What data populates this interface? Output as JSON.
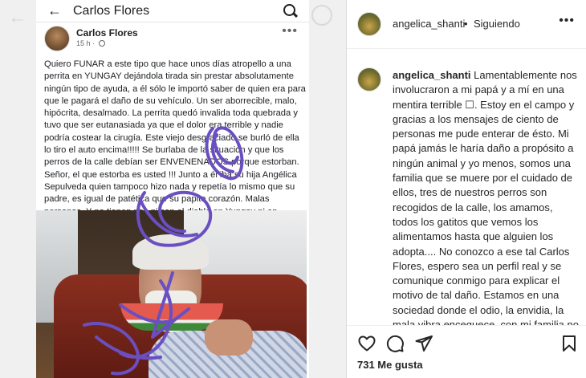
{
  "fb_post": {
    "topbar_title": "Carlos Flores",
    "author": "Carlos Flores",
    "time": "15 h",
    "text": "Quiero FUNAR  a este tipo que hace unos días atropello a una perrita en YUNGAY dejándola tirada sin prestar absolutamente ningún tipo de ayuda, a él sólo le importó saber de quien era para que le pagará el daño de su vehículo. Un ser aborrecible, malo, hipócrita, desalmado. La perrita quedó invalida toda quebrada y tuvo que ser eutanasiada ya que el dolor era terrible y nadie podría costear la cirugía. Este viejo desgraciado se burló de ella lo tiro el auto encima!!!!! Se burlaba de la situación y que los perros de la calle debían ser ENVENENADOS porque estorban. Señor, el que estorba es usted !!! Junto a él iba su hija Angélica Sepulveda quien tampoco hizo nada y repetía lo mismo que su padre, es igual de patética que su papito corazón. Malas personas. Y no tienen paz  ni con el diablo en Yungay ni en ninguna parte"
  },
  "ig": {
    "username": "angelica_shanti",
    "separator": "•",
    "follow_status": "Siguiendo",
    "caption_user": "angelica_shanti",
    "caption_text": " Lamentablemente nos involucraron a mi papá y a mí en una mentira terrible ☐. Estoy en el campo y gracias a los mensajes de ciento de personas me pude enterar de ésto. Mi papá jamás le haría daño a propósito a ningún animal y yo menos, somos una familia que se muere por el cuidado de ellos, tres de nuestros perros son recogidos de la calle, los amamos, todos los gatitos que vemos los alimentamos hasta que alguien los adopta.... No conozco a ese tal Carlos Flores, espero sea un perfil real y se comunique conmigo para explicar el motivo de tal daño. Estamos en una sociedad donde el odio, la envidia, la mala vibra enceguece, con mi familia no le hacemos daño a nadie, ha sido un año muy difícil para nosotros, sobre",
    "likes": "731 Me gusta"
  },
  "icons": {
    "back": "arrow-left-icon",
    "search": "search-icon",
    "more": "more-dots-icon",
    "like": "heart-icon",
    "comment": "comment-bubble-icon",
    "share": "paper-plane-icon",
    "save": "bookmark-icon"
  },
  "colors": {
    "scribble": "#6a4fc1",
    "text": "#262626",
    "secondary": "#65676b"
  }
}
